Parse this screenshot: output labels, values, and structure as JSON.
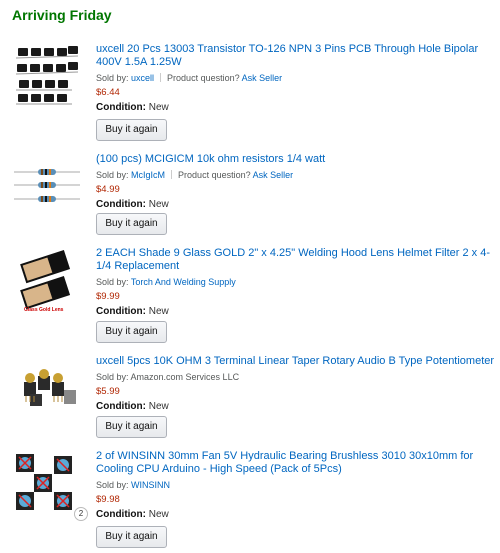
{
  "section": {
    "heading": "Arriving Friday"
  },
  "common": {
    "sold_by_prefix": "Sold by: ",
    "question_prompt": "Product question? ",
    "ask_seller": "Ask Seller",
    "condition_label": "Condition: ",
    "buy_again": "Buy it again"
  },
  "items": [
    {
      "title": "uxcell 20 Pcs 13003 Transistor TO-126 NPN 3 Pins PCB Through Hole Bipolar 400V 1.5A 1.25W",
      "seller": "uxcell",
      "price": "$6.44",
      "condition": "New",
      "image_icon": "transistor-pack-icon"
    },
    {
      "title": "(100 pcs) MCIGICM 10k ohm resistors 1/4 watt",
      "seller": "McIgIcM",
      "price": "$4.99",
      "condition": "New",
      "image_icon": "resistor-icon"
    },
    {
      "title": "2 EACH Shade 9 Glass GOLD 2\" x 4.25\" Welding Hood Lens Helmet Filter 2 x 4-1/4 Replacement",
      "seller": "Torch And Welding Supply",
      "price": "$9.99",
      "condition": "New",
      "image_icon": "welding-lens-icon",
      "image_caption": "Glass Gold Lens"
    },
    {
      "title": "uxcell 5pcs 10K OHM 3 Terminal Linear Taper Rotary Audio B Type Potentiometer",
      "seller": "Amazon.com Services LLC",
      "price": "$5.99",
      "condition": "New",
      "image_icon": "potentiometer-icon"
    },
    {
      "title": "2 of WINSINN 30mm Fan 5V Hydraulic Bearing Brushless 3010 30x10mm for Cooling CPU Arduino - High Speed (Pack of 5Pcs)",
      "seller": "WINSINN",
      "price": "$9.98",
      "condition": "New",
      "image_icon": "cooling-fan-icon",
      "quantity_badge": "2"
    }
  ],
  "colors": {
    "heading_green": "#007600",
    "link_blue": "#0066c0",
    "price_red": "#b12704"
  }
}
